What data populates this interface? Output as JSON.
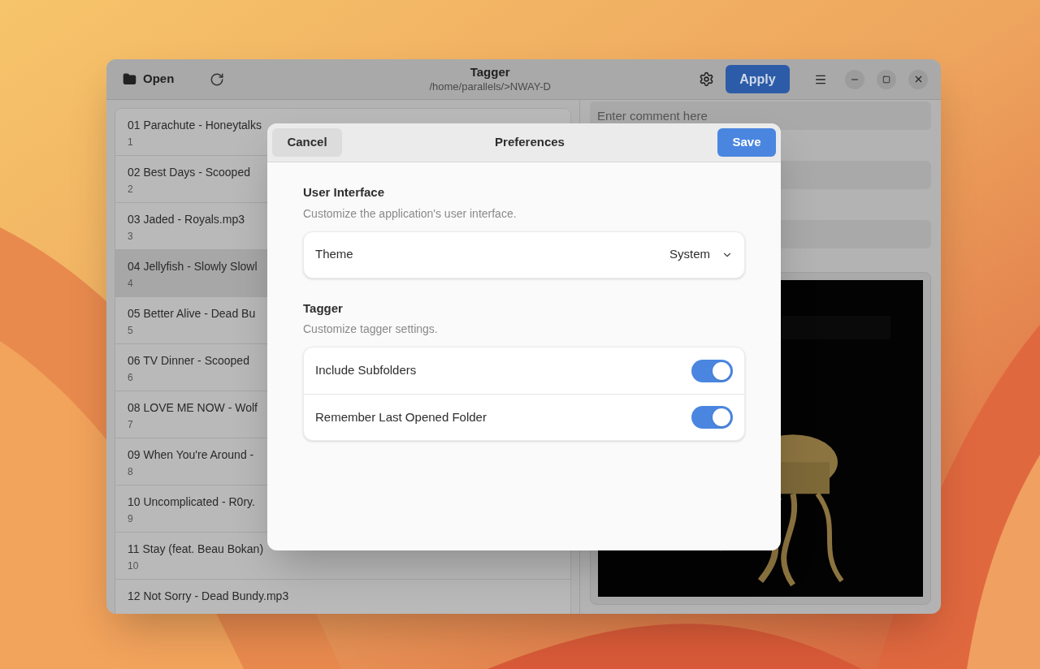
{
  "window": {
    "title": "Tagger",
    "subtitle": "/home/parallels/>NWAY-D",
    "open_button": "Open",
    "apply_button": "Apply"
  },
  "files": [
    {
      "title": "01 Parachute - Honeytalks",
      "number": "1",
      "selected": false
    },
    {
      "title": "02 Best Days - Scooped",
      "number": "2",
      "selected": false
    },
    {
      "title": "03 Jaded - Royals.mp3",
      "number": "3",
      "selected": false
    },
    {
      "title": "04 Jellyfish - Slowly Slowl",
      "number": "4",
      "selected": true
    },
    {
      "title": "05 Better Alive - Dead Bu",
      "number": "5",
      "selected": false
    },
    {
      "title": "06 TV Dinner - Scooped",
      "number": "6",
      "selected": false
    },
    {
      "title": "08 LOVE ME NOW - Wolf",
      "number": "7",
      "selected": false
    },
    {
      "title": "09 When You're Around -",
      "number": "8",
      "selected": false
    },
    {
      "title": "10 Uncomplicated - R0ry.",
      "number": "9",
      "selected": false
    },
    {
      "title": "11 Stay (feat. Beau Bokan)",
      "number": "10",
      "selected": false
    },
    {
      "title": "12 Not Sorry - Dead Bundy.mp3",
      "selected": false
    }
  ],
  "comment_field": {
    "placeholder": "Enter comment here"
  },
  "dialog": {
    "title": "Preferences",
    "cancel_button": "Cancel",
    "save_button": "Save",
    "sections": [
      {
        "title": "User Interface",
        "description": "Customize the application's user interface.",
        "rows": [
          {
            "kind": "dropdown",
            "label": "Theme",
            "value": "System"
          }
        ]
      },
      {
        "title": "Tagger",
        "description": "Customize tagger settings.",
        "rows": [
          {
            "kind": "switch",
            "label": "Include Subfolders",
            "on": true
          },
          {
            "kind": "switch",
            "label": "Remember Last Opened Folder",
            "on": true
          }
        ]
      }
    ]
  }
}
